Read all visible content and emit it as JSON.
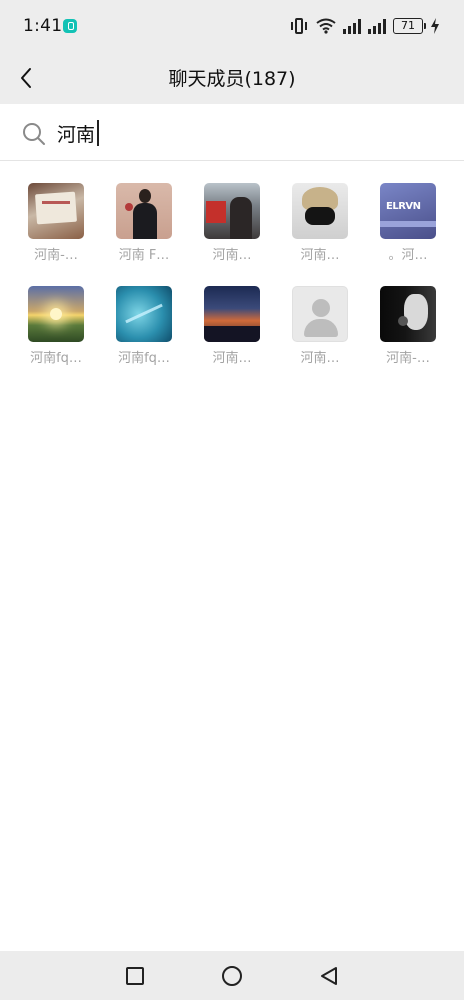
{
  "status_bar": {
    "time": "1:41",
    "battery": "71",
    "app_icon": "shield-app-icon",
    "icons": [
      "vibrate-icon",
      "wifi-icon",
      "signal-icon",
      "signal-icon",
      "battery-icon",
      "charging-icon"
    ]
  },
  "header": {
    "title": "聊天成员(187)",
    "back_icon": "chevron-left-icon",
    "background": "#ededed"
  },
  "search": {
    "value": "河南",
    "icon": "search-icon"
  },
  "members": [
    {
      "name": "河南-…"
    },
    {
      "name": "河南 F…"
    },
    {
      "name": "河南…"
    },
    {
      "name": "河南…"
    },
    {
      "name": "。河…"
    },
    {
      "name": "河南fq…"
    },
    {
      "name": "河南fq…"
    },
    {
      "name": "河南…"
    },
    {
      "name": "河南…"
    },
    {
      "name": "河南-…"
    }
  ],
  "avatar_label_text": "ELRVN",
  "nav_bar": {
    "icons": [
      "recent-apps-icon",
      "home-icon",
      "back-triangle-icon"
    ]
  },
  "colors": {
    "member_name": "#a3a3a3",
    "bar_background": "#ededed"
  }
}
